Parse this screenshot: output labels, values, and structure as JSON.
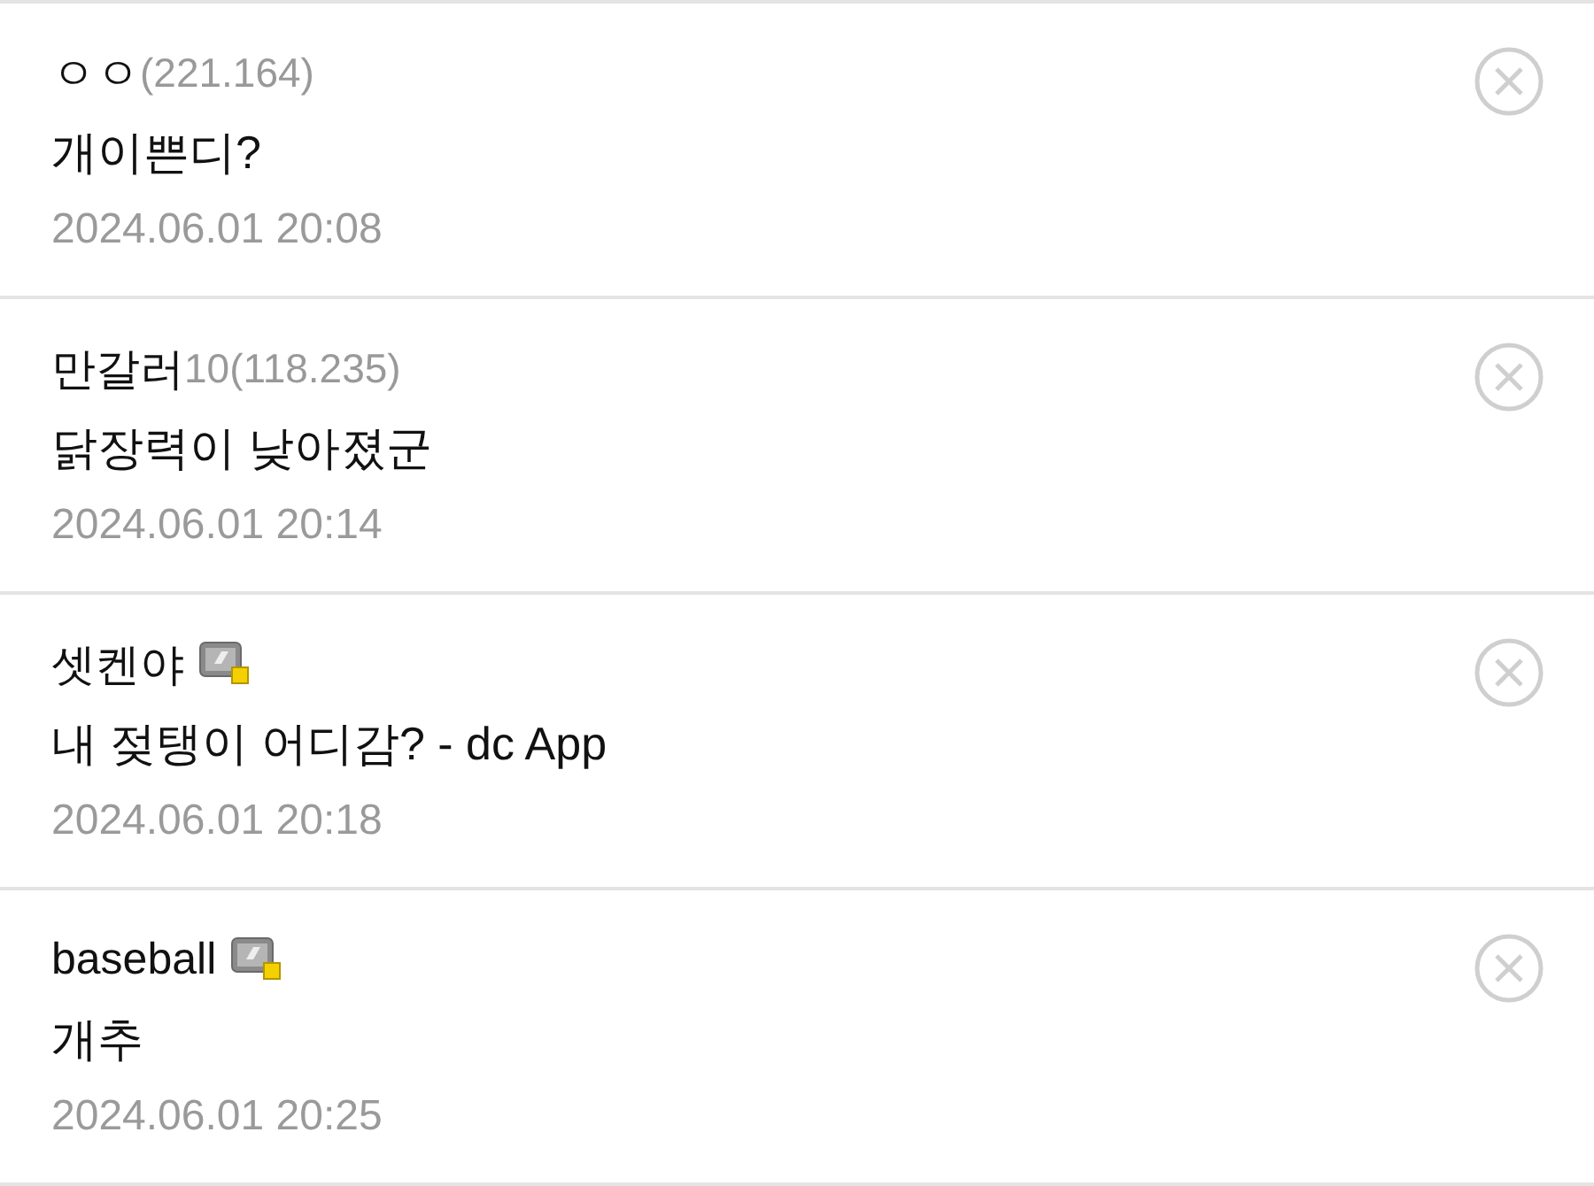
{
  "comments": [
    {
      "name": "ㅇㅇ",
      "ip": "(221.164)",
      "badge": false,
      "content": "개이쁜디?",
      "date": "2024.06.01 20:08"
    },
    {
      "name": "만갈러",
      "ip": "10(118.235)",
      "badge": false,
      "content": "닭장력이 낮아졌군",
      "date": "2024.06.01 20:14"
    },
    {
      "name": "셋켄야",
      "badge": true,
      "content": "내 젖탱이 어디감? - dc App",
      "date": "2024.06.01 20:18"
    },
    {
      "name": "baseball",
      "badge": true,
      "content": "개추",
      "date": "2024.06.01 20:25"
    }
  ]
}
